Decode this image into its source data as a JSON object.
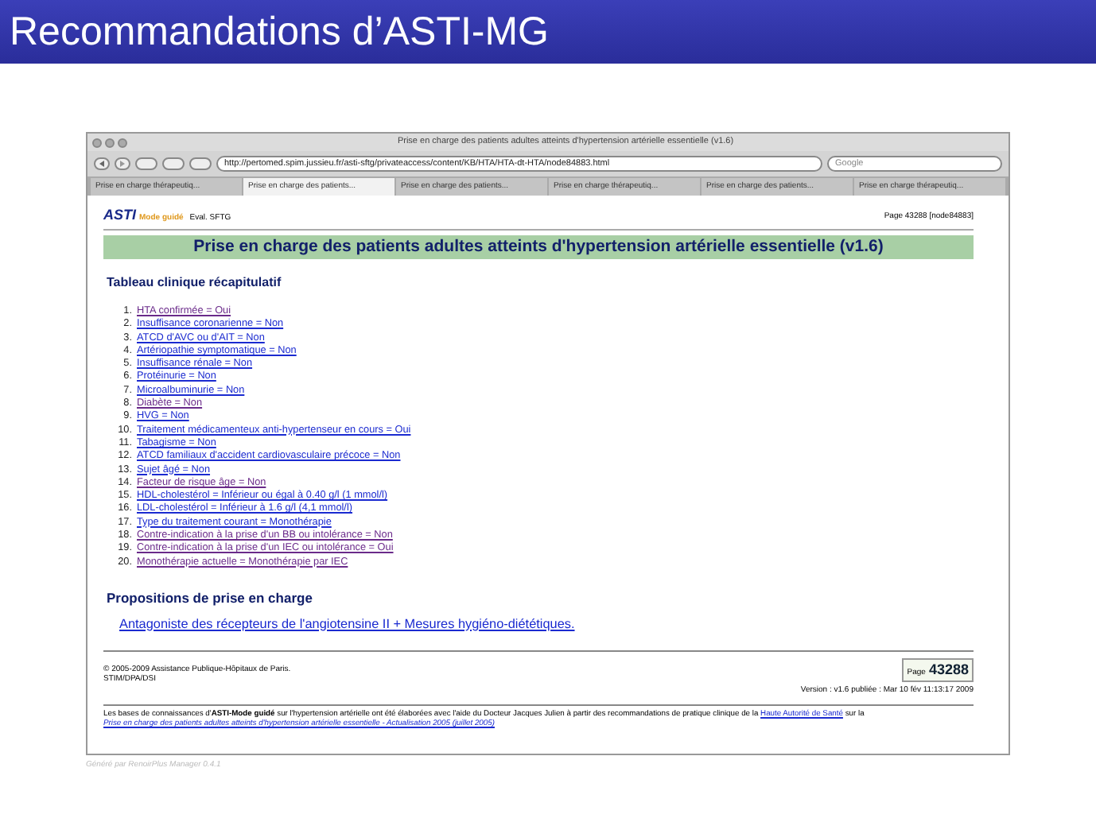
{
  "slide": {
    "title": "Recommandations d’ASTI-MG"
  },
  "browser": {
    "window_title": "Prise en charge des patients adultes atteints d'hypertension artérielle essentielle (v1.6)",
    "url": "http://pertomed.spim.jussieu.fr/asti-sftg/privateaccess/content/KB/HTA/HTA-dt-HTA/node84883.html",
    "search_placeholder": "Google",
    "tabs": [
      {
        "label": "Prise en charge thérapeutiq...",
        "selected": false
      },
      {
        "label": "Prise en charge des patients...",
        "selected": true
      },
      {
        "label": "Prise en charge des patients...",
        "selected": false
      },
      {
        "label": "Prise en charge thérapeutiq...",
        "selected": false
      },
      {
        "label": "Prise en charge des patients...",
        "selected": false
      },
      {
        "label": "Prise en charge thérapeutiq...",
        "selected": false
      }
    ]
  },
  "page": {
    "logo": {
      "brand": "ASTI",
      "sub": "Mode guidé",
      "extra": "Eval. SFTG"
    },
    "page_ref": "Page 43288 [node84883]",
    "title": "Prise en charge des patients adultes atteints d'hypertension artérielle essentielle (v1.6)",
    "section_1": "Tableau clinique récapitulatif",
    "items": [
      {
        "num": "1.",
        "text": "HTA confirmée = Oui",
        "visited": true
      },
      {
        "num": "2.",
        "text": "Insuffisance coronarienne = Non",
        "visited": false
      },
      {
        "num": "3.",
        "text": "ATCD d'AVC ou d'AIT = Non",
        "visited": false
      },
      {
        "num": "4.",
        "text": "Artériopathie symptomatique = Non",
        "visited": false
      },
      {
        "num": "5.",
        "text": "Insuffisance rénale = Non",
        "visited": false
      },
      {
        "num": "6.",
        "text": "Protéinurie = Non",
        "visited": false
      },
      {
        "num": "7.",
        "text": "Microalbuminurie = Non",
        "visited": false
      },
      {
        "num": "8.",
        "text": "Diabète = Non",
        "visited": true
      },
      {
        "num": "9.",
        "text": "HVG = Non",
        "visited": false
      },
      {
        "num": "10.",
        "text": "Traitement médicamenteux anti-hypertenseur en cours = Oui",
        "visited": false
      },
      {
        "num": "11.",
        "text": "Tabagisme = Non",
        "visited": false
      },
      {
        "num": "12.",
        "text": "ATCD familiaux d'accident cardiovasculaire précoce = Non",
        "visited": false
      },
      {
        "num": "13.",
        "text": "Sujet âgé = Non",
        "visited": false
      },
      {
        "num": "14.",
        "text": "Facteur de risque âge = Non",
        "visited": true
      },
      {
        "num": "15.",
        "text": "HDL-cholestérol = Inférieur ou égal à 0.40 g/l (1 mmol/l)",
        "visited": false
      },
      {
        "num": "16.",
        "text": "LDL-cholestérol = Inférieur à 1.6 g/l (4,1 mmol/l)",
        "visited": false
      },
      {
        "num": "17.",
        "text": "Type du traitement courant = Monothérapie",
        "visited": false
      },
      {
        "num": "18.",
        "text": "Contre-indication à la prise d'un BB ou intolérance = Non",
        "visited": true
      },
      {
        "num": "19.",
        "text": "Contre-indication à la prise d'un IEC ou intolérance = Oui",
        "visited": true
      },
      {
        "num": "20.",
        "text": "Monothérapie actuelle = Monothérapie par IEC",
        "visited": true
      }
    ],
    "section_2": "Propositions de prise en charge",
    "proposal": "Antagoniste des récepteurs de l'angiotensine II + Mesures hygiéno-diététiques.",
    "copyright": "© 2005-2009 Assistance Publique-Hôpitaux de Paris.",
    "dept": "STIM/DPA/DSI",
    "page_box_label": "Page",
    "page_box_number": "43288",
    "version": "Version : v1.6 publiée : Mar 10 fév 11:13:17 2009",
    "note_before": "Les bases de connaissances d'**ASTI-Mode guidé** sur l'hypertension artérielle ont été élaborées avec l'aide du Docteur Jacques Julien à partir des recommandations de pratique clinique de la",
    "note_link": "Haute Autorité de Santé",
    "note_after": "sur la",
    "note_ref": "Prise en charge des patients adultes atteints d'hypertension artérielle essentielle - Actualisation 2005 (juillet 2005)"
  },
  "generator": "Généré par RenoirPlus Manager 0.4.1"
}
